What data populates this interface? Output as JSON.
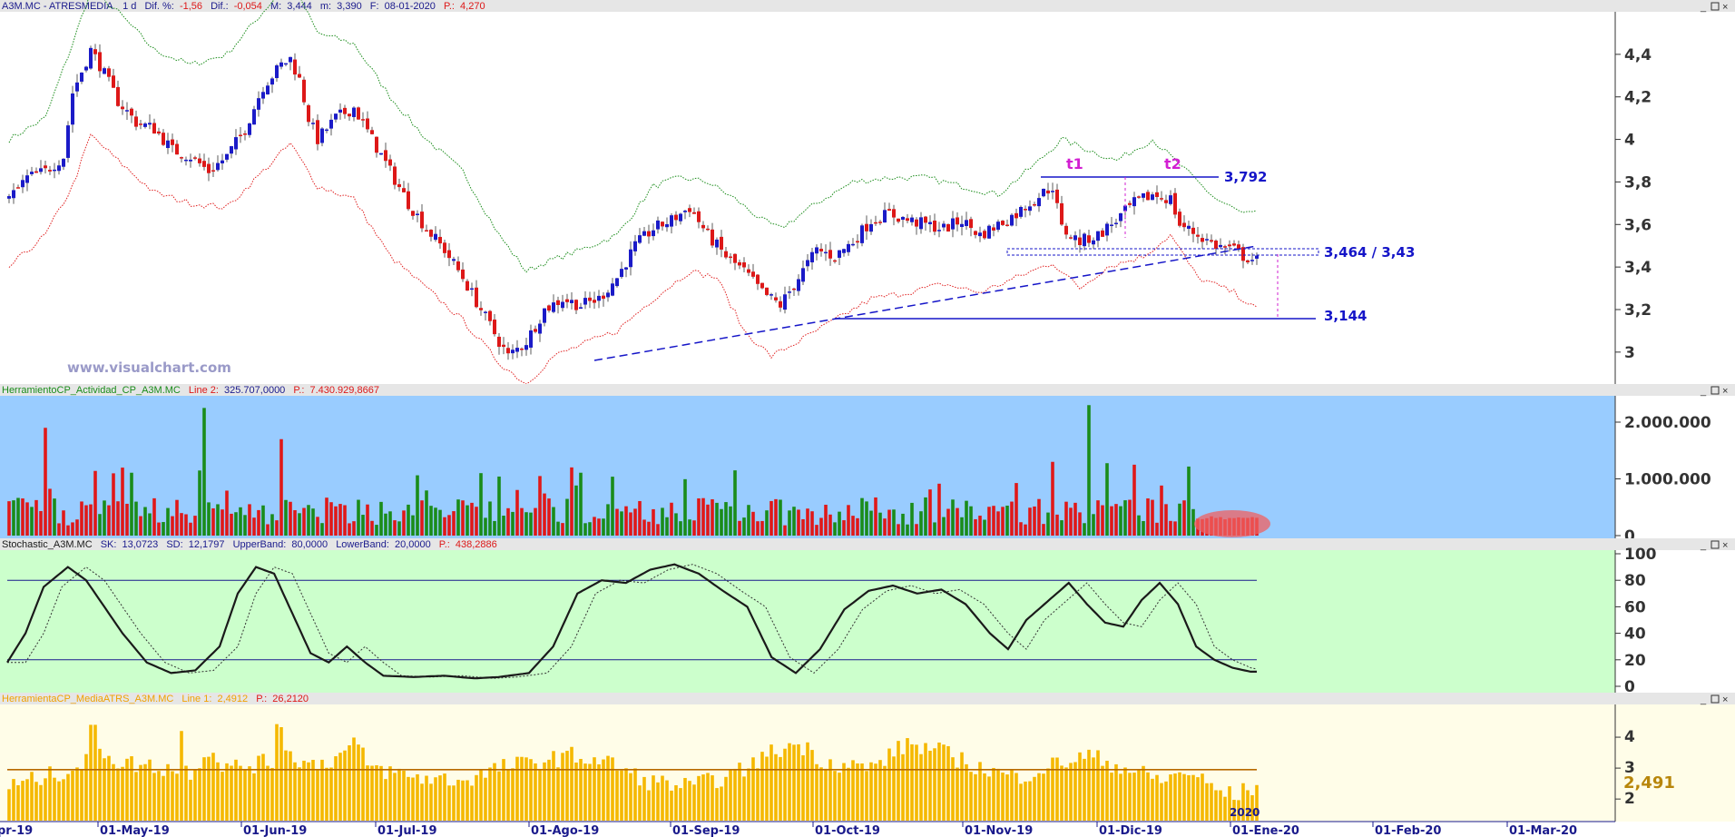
{
  "panes": {
    "price": {
      "header": {
        "symbol": "A3M.MC - ATRESMEDIA",
        "interval": "1 d",
        "dif_pct_label": "Dif. %:",
        "dif_pct": "-1,56",
        "dif_label": "Dif.:",
        "dif": "-0,054",
        "max_label": "M:",
        "max": "3,444",
        "min_label": "m:",
        "min": "3,390",
        "date_label": "F:",
        "date": "08-01-2020",
        "p_label": "P.:",
        "p": "4,270"
      },
      "watermark": "www.visualchart.com",
      "annotations": {
        "t1": "t1",
        "t2": "t2",
        "resistance": "3,792",
        "support_zone": "3,464 / 3,43",
        "target": "3,144"
      }
    },
    "volume": {
      "header": {
        "name": "HerramientoCP_Actividad_CP_A3M.MC",
        "line_label": "Line 2:",
        "line_value": "325.707,0000",
        "p_label": "P.:",
        "p": "7.430.929,8667"
      }
    },
    "stochastic": {
      "header": {
        "name": "Stochastic_A3M.MC",
        "sk_label": "SK:",
        "sk": "13,0723",
        "sd_label": "SD:",
        "sd": "12,1797",
        "upper_label": "UpperBand:",
        "upper": "80,0000",
        "lower_label": "LowerBand:",
        "lower": "20,0000",
        "p_label": "P.:",
        "p": "438,2886"
      }
    },
    "atr": {
      "header": {
        "name": "HerramientaCP_MediaATRS_A3M.MC",
        "line_label": "Line 1:",
        "line_value": "2,4912",
        "p_label": "P.:",
        "p": "26,2120"
      },
      "last_value": "2,491",
      "year_marker": "2020"
    }
  },
  "window_buttons": [
    "_",
    "□",
    "×"
  ],
  "x_axis": [
    "pr-19",
    "01-May-19",
    "01-Jun-19",
    "01-Jul-19",
    "01-Ago-19",
    "01-Sep-19",
    "01-Oct-19",
    "01-Nov-19",
    "01-Dic-19",
    "01-Ene-20",
    "01-Feb-20",
    "01-Mar-20"
  ],
  "colors": {
    "up": "#1b1bc8",
    "down": "#dd1818",
    "volume_up": "#1a8c1a",
    "volume_down": "#e01818",
    "vol_bg": "#99ccff",
    "stoch_bg": "#ccffcc",
    "atr_bg": "#fffde8",
    "atr_bar": "#f5b800",
    "upper_band": "#1a8c1a",
    "lower_band": "#e02020",
    "trend": "#1515c8",
    "magenta": "#d21fd2"
  },
  "chart_data": [
    {
      "type": "candlestick",
      "title": "A3M.MC - ATRESMEDIA",
      "x_start": "Apr-19",
      "x_end": "Mar-20",
      "y_ticks": [
        "3",
        "3,2",
        "3,4",
        "3,6",
        "3,8",
        "4",
        "4,2",
        "4,4"
      ],
      "ylim": [
        2.85,
        4.6
      ],
      "levels": [
        3.792,
        3.464,
        3.43,
        3.144
      ],
      "closes_path": [
        [
          0,
          3.72
        ],
        [
          4,
          3.82
        ],
        [
          8,
          3.85
        ],
        [
          12,
          3.92
        ],
        [
          14,
          4.22
        ],
        [
          18,
          4.42
        ],
        [
          20,
          4.35
        ],
        [
          24,
          4.18
        ],
        [
          28,
          4.08
        ],
        [
          32,
          4.05
        ],
        [
          36,
          3.95
        ],
        [
          40,
          3.92
        ],
        [
          44,
          3.85
        ],
        [
          48,
          3.92
        ],
        [
          52,
          4.05
        ],
        [
          56,
          4.25
        ],
        [
          60,
          4.35
        ],
        [
          62,
          4.38
        ],
        [
          64,
          4.28
        ],
        [
          66,
          4.1
        ],
        [
          68,
          4.0
        ],
        [
          72,
          4.1
        ],
        [
          76,
          4.15
        ],
        [
          80,
          4.0
        ],
        [
          84,
          3.85
        ],
        [
          88,
          3.7
        ],
        [
          92,
          3.58
        ],
        [
          96,
          3.48
        ],
        [
          100,
          3.35
        ],
        [
          104,
          3.2
        ],
        [
          108,
          3.05
        ],
        [
          110,
          2.98
        ],
        [
          114,
          3.05
        ],
        [
          118,
          3.2
        ],
        [
          122,
          3.25
        ],
        [
          126,
          3.22
        ],
        [
          130,
          3.25
        ],
        [
          134,
          3.35
        ],
        [
          138,
          3.5
        ],
        [
          142,
          3.58
        ],
        [
          146,
          3.62
        ],
        [
          150,
          3.68
        ],
        [
          154,
          3.55
        ],
        [
          158,
          3.45
        ],
        [
          162,
          3.38
        ],
        [
          166,
          3.28
        ],
        [
          170,
          3.22
        ],
        [
          174,
          3.35
        ],
        [
          178,
          3.48
        ],
        [
          182,
          3.45
        ],
        [
          186,
          3.52
        ],
        [
          190,
          3.62
        ],
        [
          194,
          3.65
        ],
        [
          198,
          3.62
        ],
        [
          202,
          3.6
        ],
        [
          206,
          3.58
        ],
        [
          210,
          3.62
        ],
        [
          214,
          3.55
        ],
        [
          218,
          3.6
        ],
        [
          222,
          3.65
        ],
        [
          226,
          3.72
        ],
        [
          230,
          3.78
        ],
        [
          232,
          3.58
        ],
        [
          236,
          3.52
        ],
        [
          240,
          3.55
        ],
        [
          244,
          3.62
        ],
        [
          248,
          3.7
        ],
        [
          252,
          3.74
        ],
        [
          256,
          3.72
        ],
        [
          258,
          3.6
        ],
        [
          262,
          3.55
        ],
        [
          266,
          3.5
        ],
        [
          270,
          3.48
        ],
        [
          272,
          3.45
        ],
        [
          275,
          3.43
        ]
      ],
      "upper_band_path": [
        [
          0,
          4.0
        ],
        [
          8,
          4.1
        ],
        [
          14,
          4.45
        ],
        [
          18,
          4.7
        ],
        [
          24,
          4.6
        ],
        [
          32,
          4.42
        ],
        [
          40,
          4.35
        ],
        [
          48,
          4.4
        ],
        [
          56,
          4.6
        ],
        [
          62,
          4.75
        ],
        [
          68,
          4.5
        ],
        [
          76,
          4.45
        ],
        [
          84,
          4.2
        ],
        [
          92,
          4.0
        ],
        [
          100,
          3.85
        ],
        [
          108,
          3.55
        ],
        [
          114,
          3.38
        ],
        [
          118,
          3.42
        ],
        [
          126,
          3.48
        ],
        [
          134,
          3.55
        ],
        [
          142,
          3.78
        ],
        [
          148,
          3.82
        ],
        [
          154,
          3.8
        ],
        [
          160,
          3.72
        ],
        [
          166,
          3.62
        ],
        [
          170,
          3.58
        ],
        [
          178,
          3.7
        ],
        [
          186,
          3.8
        ],
        [
          194,
          3.82
        ],
        [
          202,
          3.82
        ],
        [
          210,
          3.78
        ],
        [
          218,
          3.74
        ],
        [
          226,
          3.88
        ],
        [
          232,
          4.0
        ],
        [
          238,
          3.95
        ],
        [
          244,
          3.9
        ],
        [
          252,
          4.0
        ],
        [
          258,
          3.88
        ],
        [
          266,
          3.72
        ],
        [
          272,
          3.65
        ]
      ],
      "lower_band_path": [
        [
          0,
          3.4
        ],
        [
          8,
          3.55
        ],
        [
          14,
          3.78
        ],
        [
          18,
          4.02
        ],
        [
          24,
          3.9
        ],
        [
          32,
          3.75
        ],
        [
          40,
          3.7
        ],
        [
          48,
          3.68
        ],
        [
          56,
          3.85
        ],
        [
          62,
          3.98
        ],
        [
          68,
          3.78
        ],
        [
          76,
          3.72
        ],
        [
          84,
          3.45
        ],
        [
          92,
          3.3
        ],
        [
          100,
          3.15
        ],
        [
          108,
          2.95
        ],
        [
          114,
          2.85
        ],
        [
          120,
          2.98
        ],
        [
          128,
          3.05
        ],
        [
          134,
          3.1
        ],
        [
          142,
          3.25
        ],
        [
          150,
          3.38
        ],
        [
          156,
          3.35
        ],
        [
          162,
          3.1
        ],
        [
          168,
          2.98
        ],
        [
          174,
          3.05
        ],
        [
          182,
          3.15
        ],
        [
          190,
          3.25
        ],
        [
          198,
          3.28
        ],
        [
          206,
          3.32
        ],
        [
          214,
          3.28
        ],
        [
          222,
          3.35
        ],
        [
          230,
          3.42
        ],
        [
          236,
          3.3
        ],
        [
          242,
          3.4
        ],
        [
          250,
          3.45
        ],
        [
          256,
          3.55
        ],
        [
          262,
          3.35
        ],
        [
          270,
          3.28
        ],
        [
          275,
          3.2
        ]
      ]
    },
    {
      "type": "bar",
      "title": "HerramientoCP_Actividad_CP_A3M.MC",
      "y_ticks": [
        "2.000.000",
        "1.000.000",
        "0"
      ],
      "ylim": [
        0,
        2400000
      ],
      "highlight_spikes": [
        [
          8,
          1900000
        ],
        [
          43,
          2250000
        ],
        [
          60,
          1700000
        ],
        [
          117,
          1050000
        ],
        [
          160,
          1150000
        ],
        [
          230,
          1300000
        ],
        [
          238,
          2300000
        ],
        [
          248,
          1250000
        ]
      ],
      "typical_volume": 450000
    },
    {
      "type": "line",
      "title": "Stochastic_A3M.MC",
      "y_ticks": [
        "100",
        "80",
        "60",
        "40",
        "20",
        "0"
      ],
      "ylim": [
        0,
        100
      ],
      "bands": [
        80,
        20
      ],
      "sk_path": [
        [
          0,
          18
        ],
        [
          6,
          40
        ],
        [
          12,
          75
        ],
        [
          20,
          90
        ],
        [
          26,
          80
        ],
        [
          32,
          60
        ],
        [
          38,
          40
        ],
        [
          46,
          18
        ],
        [
          54,
          10
        ],
        [
          62,
          12
        ],
        [
          70,
          30
        ],
        [
          76,
          70
        ],
        [
          82,
          90
        ],
        [
          88,
          85
        ],
        [
          94,
          55
        ],
        [
          100,
          25
        ],
        [
          106,
          18
        ],
        [
          112,
          30
        ],
        [
          118,
          18
        ],
        [
          124,
          8
        ],
        [
          134,
          7
        ],
        [
          144,
          8
        ],
        [
          154,
          6
        ],
        [
          162,
          7
        ],
        [
          172,
          10
        ],
        [
          180,
          30
        ],
        [
          188,
          70
        ],
        [
          196,
          80
        ],
        [
          204,
          78
        ],
        [
          212,
          88
        ],
        [
          220,
          92
        ],
        [
          228,
          85
        ],
        [
          236,
          72
        ],
        [
          244,
          60
        ],
        [
          252,
          22
        ],
        [
          260,
          10
        ],
        [
          268,
          28
        ],
        [
          276,
          58
        ],
        [
          284,
          72
        ],
        [
          292,
          76
        ],
        [
          300,
          70
        ],
        [
          308,
          73
        ],
        [
          316,
          62
        ],
        [
          324,
          40
        ],
        [
          330,
          28
        ],
        [
          336,
          50
        ],
        [
          342,
          62
        ],
        [
          350,
          78
        ],
        [
          356,
          62
        ],
        [
          362,
          48
        ],
        [
          368,
          45
        ],
        [
          374,
          65
        ],
        [
          380,
          78
        ],
        [
          386,
          62
        ],
        [
          392,
          30
        ],
        [
          398,
          20
        ],
        [
          404,
          14
        ],
        [
          410,
          11
        ]
      ]
    },
    {
      "type": "bar",
      "title": "HerramientaCP_MediaATRS_A3M.MC",
      "y_ticks": [
        "4",
        "3",
        "2"
      ],
      "ylim": [
        1.3,
        5.0
      ],
      "average_level": 2.95,
      "last_value": 2.491
    }
  ]
}
